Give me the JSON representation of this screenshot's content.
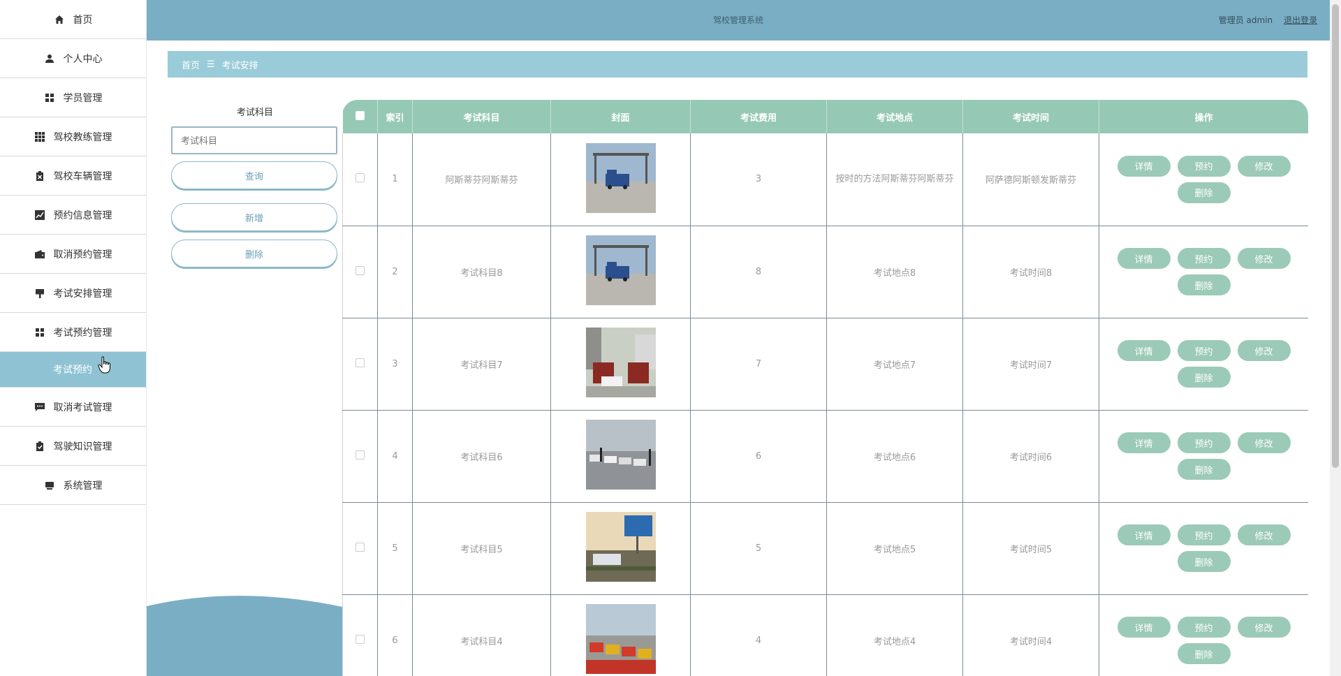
{
  "header": {
    "title": "驾校管理系统",
    "user": "管理员 admin",
    "logout": "退出登录"
  },
  "sidebar": {
    "items": [
      {
        "label": "首页",
        "icon": "home-icon"
      },
      {
        "label": "个人中心",
        "icon": "user-icon"
      },
      {
        "label": "学员管理",
        "icon": "grid-icon"
      },
      {
        "label": "驾校教练管理",
        "icon": "apps-icon"
      },
      {
        "label": "驾校车辆管理",
        "icon": "clipboard-icon"
      },
      {
        "label": "预约信息管理",
        "icon": "chart-icon"
      },
      {
        "label": "取消预约管理",
        "icon": "wallet-icon"
      },
      {
        "label": "考试安排管理",
        "icon": "brush-icon"
      },
      {
        "label": "考试预约管理",
        "icon": "grid-icon"
      },
      {
        "label": "考试预约",
        "icon": ""
      },
      {
        "label": "取消考试管理",
        "icon": "message-icon"
      },
      {
        "label": "驾驶知识管理",
        "icon": "check-clipboard-icon"
      },
      {
        "label": "系统管理",
        "icon": "monitor-icon"
      }
    ]
  },
  "breadcrumb": {
    "home": "首页",
    "sep": "☰",
    "current": "考试安排"
  },
  "search": {
    "label": "考试科目",
    "placeholder": "考试科目",
    "query_button": "查询",
    "add_button": "新增",
    "delete_button": "删除"
  },
  "table": {
    "columns": [
      "索引",
      "考试科目",
      "封面",
      "考试费用",
      "考试地点",
      "考试时间",
      "操作"
    ],
    "actions": [
      "详情",
      "预约",
      "修改",
      "删除"
    ],
    "rows": [
      {
        "index": "1",
        "subject": "阿斯蒂芬阿斯蒂芬",
        "fee": "3",
        "location": "按时的方法阿斯蒂芬阿斯蒂芬",
        "time": "阿萨德阿斯顿发斯蒂芬"
      },
      {
        "index": "2",
        "subject": "考试科目8",
        "fee": "8",
        "location": "考试地点8",
        "time": "考试时间8"
      },
      {
        "index": "3",
        "subject": "考试科目7",
        "fee": "7",
        "location": "考试地点7",
        "time": "考试时间7"
      },
      {
        "index": "4",
        "subject": "考试科目6",
        "fee": "6",
        "location": "考试地点6",
        "time": "考试时间6"
      },
      {
        "index": "5",
        "subject": "考试科目5",
        "fee": "5",
        "location": "考试地点5",
        "time": "考试时间5"
      },
      {
        "index": "6",
        "subject": "考试科目4",
        "fee": "4",
        "location": "考试地点4",
        "time": "考试时间4"
      }
    ]
  },
  "colors": {
    "header": "#7aaec4",
    "breadcrumb": "#9acbd8",
    "table_head": "#96c8b6",
    "button": "#9ccab8",
    "active_menu": "#8fc3d3"
  }
}
